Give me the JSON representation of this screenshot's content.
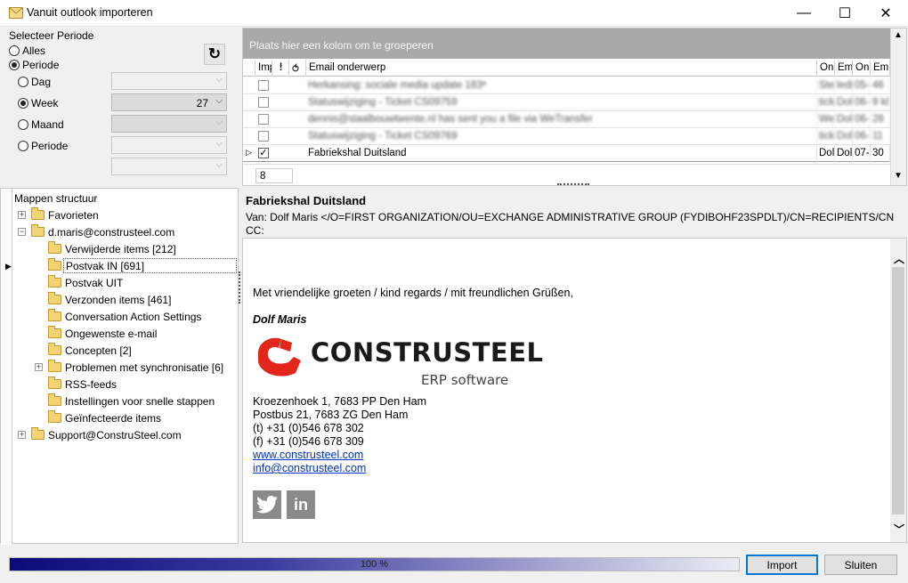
{
  "window": {
    "title": "Vanuit outlook importeren",
    "minimize": "—",
    "maximize": "☐",
    "close": "✕"
  },
  "period": {
    "group_label": "Selecteer Periode",
    "opt_all": "Alles",
    "opt_period": "Periode",
    "sub_day": "Dag",
    "sub_week": "Week",
    "sub_month": "Maand",
    "sub_period": "Periode",
    "week_value": "27",
    "refresh_icon": "refresh-icon"
  },
  "grid": {
    "group_hint": "Plaats hier een kolom om te groeperen",
    "headers": [
      "Imp",
      "!",
      "",
      "Email onderwerp",
      "On",
      "Em",
      "On",
      "Em"
    ],
    "rows": [
      {
        "subject": "Herkansing: sociale media update 183ª",
        "c1": "Ste",
        "c2": "ledi",
        "c3": "05-",
        "c4": "46",
        "checked": false,
        "blurred": true
      },
      {
        "subject": "Statuswijziging - Ticket CS09759",
        "c1": "tick",
        "c2": "Dol",
        "c3": "06-",
        "c4": "9 kl",
        "checked": false,
        "blurred": true
      },
      {
        "subject": "dennis@staalbouwtwente.nl has sent you a file via WeTransfer",
        "c1": "We",
        "c2": "Dol",
        "c3": "06-",
        "c4": "28",
        "checked": false,
        "blurred": true
      },
      {
        "subject": "Statuswijziging - Ticket CS09769",
        "c1": "tick",
        "c2": "Dol",
        "c3": "06-",
        "c4": "11",
        "checked": false,
        "blurred": true
      },
      {
        "subject": "Fabriekshal Duitsland",
        "c1": "Dol",
        "c2": "Dol",
        "c3": "07-",
        "c4": "30",
        "checked": true,
        "blurred": false
      }
    ],
    "footer_count": "8"
  },
  "tree": {
    "header": "Mappen structuur",
    "items": [
      {
        "label": "Favorieten",
        "level": 0,
        "expander": "+"
      },
      {
        "label": "d.maris@construsteel.com",
        "level": 0,
        "expander": "−"
      },
      {
        "label": "Verwijderde items [212]",
        "level": 1
      },
      {
        "label": "Postvak IN [691]",
        "level": 1,
        "selected": true
      },
      {
        "label": "Postvak UIT",
        "level": 1
      },
      {
        "label": "Verzonden items [461]",
        "level": 1
      },
      {
        "label": "Conversation Action Settings",
        "level": 1
      },
      {
        "label": "Ongewenste e-mail",
        "level": 1
      },
      {
        "label": "Concepten [2]",
        "level": 1
      },
      {
        "label": "Problemen met synchronisatie [6]",
        "level": 1,
        "expander": "+"
      },
      {
        "label": "RSS-feeds",
        "level": 1
      },
      {
        "label": "Instellingen voor snelle stappen",
        "level": 1
      },
      {
        "label": "Geïnfecteerde items",
        "level": 1
      },
      {
        "label": "Support@ConstruSteel.com",
        "level": 0,
        "expander": "+"
      }
    ]
  },
  "preview": {
    "subject": "Fabriekshal Duitsland",
    "from": "Van: Dolf Maris </O=FIRST ORGANIZATION/OU=EXCHANGE ADMINISTRATIVE GROUP (FYDIBOHF23SPDLT)/CN=RECIPIENTS/CN",
    "cc": "CC:",
    "greeting": "Met vriendelijke groeten / kind regards / mit freundlichen Grüßen,",
    "signature_name": "Dolf Maris",
    "logo_text": "CONSTRUSTEEL",
    "logo_sub": "ERP software",
    "address1": "Kroezenhoek 1, 7683 PP Den Ham",
    "address2": "Postbus 21, 7683 ZG Den Ham",
    "phone": "(t) +31 (0)546 678 302",
    "fax": "(f) +31 (0)546 678 309",
    "website": "www.construsteel.com",
    "email": "info@construsteel.com",
    "twitter_icon": "twitter-icon",
    "linkedin_icon": "linkedin-icon",
    "linkedin_glyph": "in"
  },
  "footer": {
    "progress": 1.0,
    "progress_label": "100 %",
    "import_label": "Import",
    "close_label": "Sluiten"
  }
}
